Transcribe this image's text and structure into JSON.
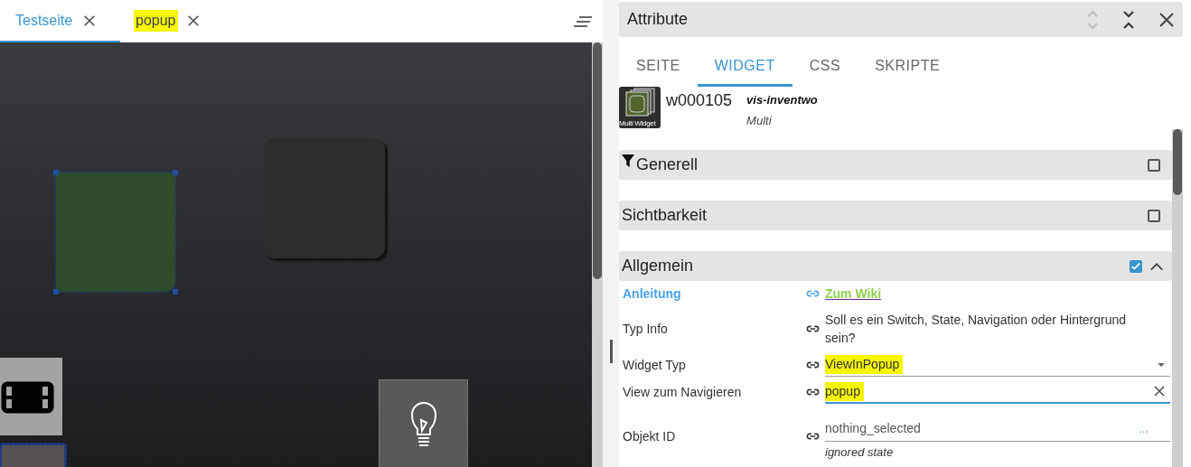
{
  "view_tabs": [
    {
      "label": "Testseite",
      "selected": true,
      "highlighted": false
    },
    {
      "label": "popup",
      "selected": false,
      "highlighted": true
    }
  ],
  "canvas": {
    "widgets": [
      {
        "kind": "green-tile",
        "selected": true
      },
      {
        "kind": "dark-tile",
        "selected": false
      },
      {
        "kind": "projector-tile",
        "selected": false
      },
      {
        "kind": "bulb-tile",
        "selected": false
      },
      {
        "kind": "frame-tile",
        "selected": true
      }
    ]
  },
  "panel": {
    "title": "Attribute",
    "tabs": [
      {
        "label": "SEITE",
        "selected": false
      },
      {
        "label": "WIDGET",
        "selected": true
      },
      {
        "label": "CSS",
        "selected": false
      },
      {
        "label": "SKRIPTE",
        "selected": false
      }
    ],
    "widget": {
      "id": "w000105",
      "set": "vis-inventwo",
      "type": "Multi",
      "thumb_label": "Multi Widget"
    },
    "groups": [
      {
        "title": "Generell",
        "filter_icon": true,
        "checked": false,
        "expanded": false
      },
      {
        "title": "Sichtbarkeit",
        "filter_icon": false,
        "checked": false,
        "expanded": false
      },
      {
        "title": "Allgemein",
        "filter_icon": false,
        "checked": true,
        "expanded": true
      }
    ],
    "fields": [
      {
        "kind": "link",
        "label": "Anleitung",
        "value": "Zum Wiki"
      },
      {
        "kind": "info",
        "label": "Typ Info",
        "value": "Soll es ein Switch, State, Navigation oder Hintergrund sein?"
      },
      {
        "kind": "select",
        "label": "Widget Typ",
        "value": "ViewInPopup",
        "highlighted": true
      },
      {
        "kind": "input",
        "label": "View zum Navigieren",
        "value": "popup",
        "highlighted": true,
        "focused": true
      },
      {
        "kind": "object",
        "label": "Objekt ID",
        "value": "nothing_selected",
        "button": "...",
        "helper": "ignored state"
      }
    ]
  }
}
